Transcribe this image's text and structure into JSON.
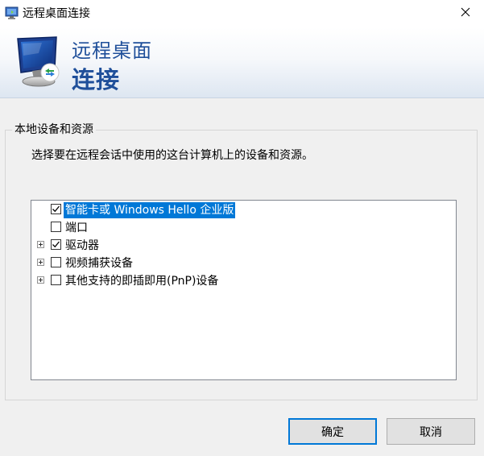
{
  "window": {
    "title": "远程桌面连接",
    "icon": "remote-desktop-icon",
    "close_icon": "close-icon"
  },
  "banner": {
    "line1": "远程桌面",
    "line2": "连接",
    "icon": "remote-desktop-monitor-icon"
  },
  "group": {
    "legend": "本地设备和资源",
    "description": "选择要在远程会话中使用的这台计算机上的设备和资源。"
  },
  "tree": {
    "items": [
      {
        "label": "智能卡或 Windows Hello 企业版",
        "checked": true,
        "expandable": false,
        "selected": true
      },
      {
        "label": "端口",
        "checked": false,
        "expandable": false,
        "selected": false
      },
      {
        "label": "驱动器",
        "checked": true,
        "expandable": true,
        "selected": false
      },
      {
        "label": "视频捕获设备",
        "checked": false,
        "expandable": true,
        "selected": false
      },
      {
        "label": "其他支持的即插即用(PnP)设备",
        "checked": false,
        "expandable": true,
        "selected": false
      }
    ]
  },
  "buttons": {
    "ok": "确定",
    "cancel": "取消"
  },
  "colors": {
    "accent": "#0078d7",
    "banner_text": "#1f4f9a",
    "background": "#f0f0f0"
  }
}
